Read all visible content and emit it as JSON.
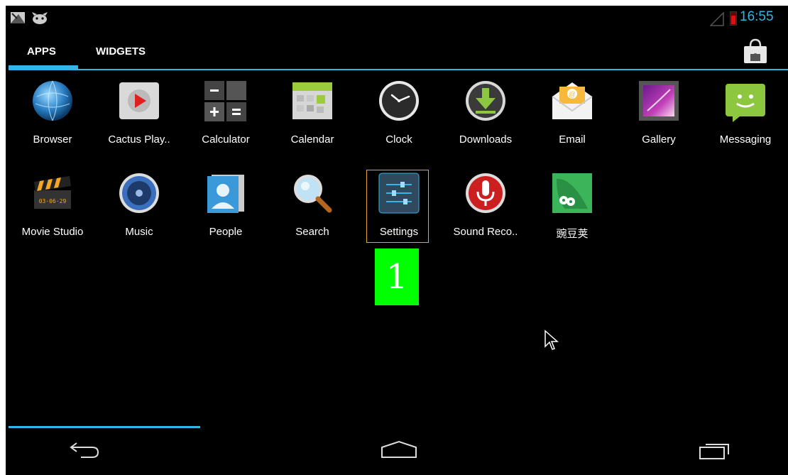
{
  "status_bar": {
    "time": "16:55",
    "icons": [
      "screenshot-icon",
      "android-icon",
      "signal-icon",
      "battery-icon"
    ]
  },
  "tabs": [
    {
      "label": "APPS",
      "selected": true
    },
    {
      "label": "WIDGETS",
      "selected": false
    }
  ],
  "store_icon": "play-store-icon",
  "apps": [
    {
      "label": "Browser",
      "icon": "browser-icon"
    },
    {
      "label": "Cactus Play..",
      "icon": "cactus-player-icon"
    },
    {
      "label": "Calculator",
      "icon": "calculator-icon"
    },
    {
      "label": "Calendar",
      "icon": "calendar-icon"
    },
    {
      "label": "Clock",
      "icon": "clock-icon"
    },
    {
      "label": "Downloads",
      "icon": "downloads-icon"
    },
    {
      "label": "Email",
      "icon": "email-icon"
    },
    {
      "label": "Gallery",
      "icon": "gallery-icon"
    },
    {
      "label": "Messaging",
      "icon": "messaging-icon"
    },
    {
      "label": "Movie Studio",
      "icon": "movie-studio-icon"
    },
    {
      "label": "Music",
      "icon": "music-icon"
    },
    {
      "label": "People",
      "icon": "people-icon"
    },
    {
      "label": "Search",
      "icon": "search-icon"
    },
    {
      "label": "Settings",
      "icon": "settings-icon"
    },
    {
      "label": "Sound Reco..",
      "icon": "sound-recorder-icon"
    },
    {
      "label": "豌豆荚",
      "icon": "wandoujia-icon"
    }
  ],
  "marker_label": "1",
  "nav": [
    "back-icon",
    "home-icon",
    "recent-apps-icon"
  ],
  "colors": {
    "accent": "#33b5e5",
    "marker": "#00ff00",
    "selection": "#e8a33c"
  }
}
